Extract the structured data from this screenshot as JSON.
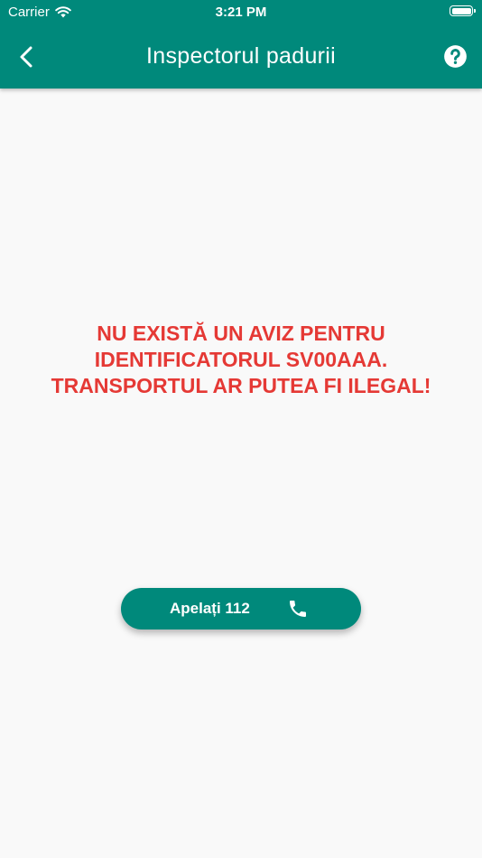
{
  "status_bar": {
    "carrier": "Carrier",
    "time": "3:21 PM",
    "wifi_icon": "wifi-icon",
    "battery_icon": "battery-icon"
  },
  "app_bar": {
    "title": "Inspectorul padurii",
    "back_icon": "chevron-left-icon",
    "help_icon": "help-circle-icon"
  },
  "message": "NU EXISTĂ UN AVIZ PENTRU\nIDENTIFICATORUL SV00AAA.\nTRANSPORTUL AR PUTEA FI ILEGAL!",
  "call_button": {
    "label": "Apelați 112",
    "icon": "phone-icon"
  },
  "colors": {
    "primary": "#00897b",
    "error_text": "#e53935",
    "background": "#f9f9f9",
    "on_primary": "#ffffff"
  }
}
